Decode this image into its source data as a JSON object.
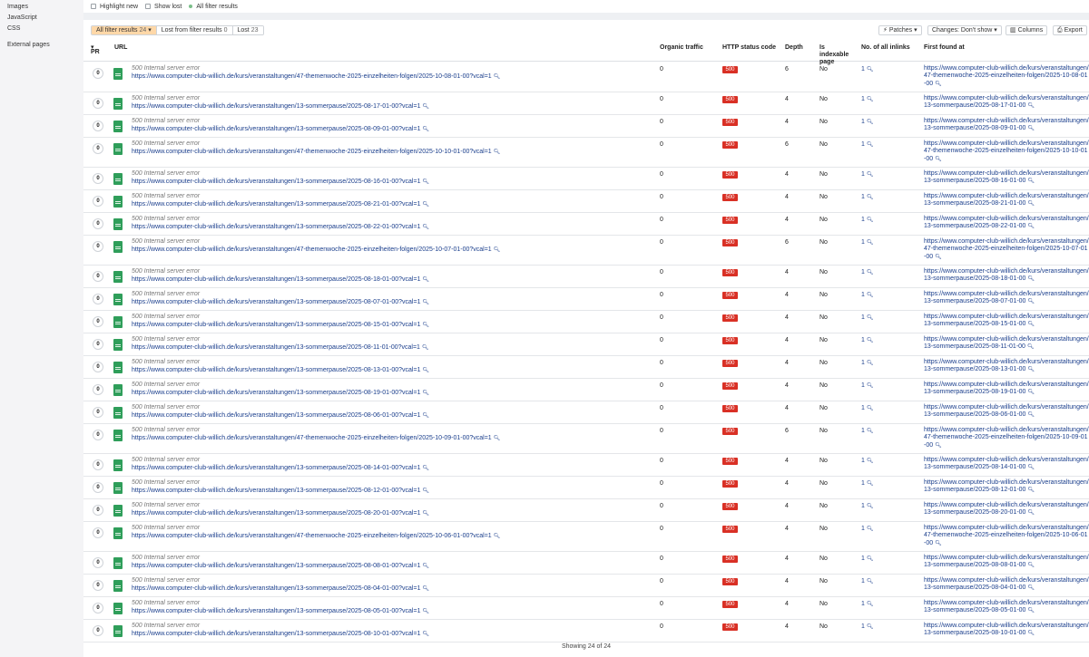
{
  "sidebar": {
    "items": [
      "Images",
      "JavaScript",
      "CSS",
      "External pages"
    ]
  },
  "filters": {
    "highlight_new": "Highlight new",
    "show_lost": "Show lost",
    "all_filter_results": "All filter results"
  },
  "tabs": [
    {
      "label": "All filter results",
      "count": "24"
    },
    {
      "label": "Lost from filter results",
      "count": "0"
    },
    {
      "label": "Lost",
      "count": "23"
    }
  ],
  "toolbar": {
    "patches": "Patches",
    "changes": "Changes: Don't show",
    "columns": "Columns",
    "export": "Export"
  },
  "columns": {
    "pr": "PR",
    "url": "URL",
    "organic_traffic": "Organic traffic",
    "http_status": "HTTP status code",
    "depth": "Depth",
    "indexable": "Is indexable page",
    "inlinks": "No. of all inlinks",
    "first_found": "First found at"
  },
  "rows": [
    {
      "pr": "0",
      "error": "500 Internal server error",
      "url": "https://www.computer-club-willich.de/kurs/veranstaltungen/47-themenwoche-2025-einzelheiten-folgen/2025-10-08-01-00?vcal=1",
      "traffic": "0",
      "status": "500",
      "depth": "6",
      "indexable": "No",
      "inlinks": "1",
      "first_found": "https://www.computer-club-willich.de/kurs/veranstaltungen/47-themenwoche-2025-einzelheiten-folgen/2025-10-08-01-00"
    },
    {
      "pr": "0",
      "error": "500 Internal server error",
      "url": "https://www.computer-club-willich.de/kurs/veranstaltungen/13-sommerpause/2025-08-17-01-00?vcal=1",
      "traffic": "0",
      "status": "500",
      "depth": "4",
      "indexable": "No",
      "inlinks": "1",
      "first_found": "https://www.computer-club-willich.de/kurs/veranstaltungen/13-sommerpause/2025-08-17-01-00"
    },
    {
      "pr": "0",
      "error": "500 Internal server error",
      "url": "https://www.computer-club-willich.de/kurs/veranstaltungen/13-sommerpause/2025-08-09-01-00?vcal=1",
      "traffic": "0",
      "status": "500",
      "depth": "4",
      "indexable": "No",
      "inlinks": "1",
      "first_found": "https://www.computer-club-willich.de/kurs/veranstaltungen/13-sommerpause/2025-08-09-01-00"
    },
    {
      "pr": "0",
      "error": "500 Internal server error",
      "url": "https://www.computer-club-willich.de/kurs/veranstaltungen/47-themenwoche-2025-einzelheiten-folgen/2025-10-10-01-00?vcal=1",
      "traffic": "0",
      "status": "500",
      "depth": "6",
      "indexable": "No",
      "inlinks": "1",
      "first_found": "https://www.computer-club-willich.de/kurs/veranstaltungen/47-themenwoche-2025-einzelheiten-folgen/2025-10-10-01-00"
    },
    {
      "pr": "0",
      "error": "500 Internal server error",
      "url": "https://www.computer-club-willich.de/kurs/veranstaltungen/13-sommerpause/2025-08-16-01-00?vcal=1",
      "traffic": "0",
      "status": "500",
      "depth": "4",
      "indexable": "No",
      "inlinks": "1",
      "first_found": "https://www.computer-club-willich.de/kurs/veranstaltungen/13-sommerpause/2025-08-16-01-00"
    },
    {
      "pr": "0",
      "error": "500 Internal server error",
      "url": "https://www.computer-club-willich.de/kurs/veranstaltungen/13-sommerpause/2025-08-21-01-00?vcal=1",
      "traffic": "0",
      "status": "500",
      "depth": "4",
      "indexable": "No",
      "inlinks": "1",
      "first_found": "https://www.computer-club-willich.de/kurs/veranstaltungen/13-sommerpause/2025-08-21-01-00"
    },
    {
      "pr": "0",
      "error": "500 Internal server error",
      "url": "https://www.computer-club-willich.de/kurs/veranstaltungen/13-sommerpause/2025-08-22-01-00?vcal=1",
      "traffic": "0",
      "status": "500",
      "depth": "4",
      "indexable": "No",
      "inlinks": "1",
      "first_found": "https://www.computer-club-willich.de/kurs/veranstaltungen/13-sommerpause/2025-08-22-01-00"
    },
    {
      "pr": "0",
      "error": "500 Internal server error",
      "url": "https://www.computer-club-willich.de/kurs/veranstaltungen/47-themenwoche-2025-einzelheiten-folgen/2025-10-07-01-00?vcal=1",
      "traffic": "0",
      "status": "500",
      "depth": "6",
      "indexable": "No",
      "inlinks": "1",
      "first_found": "https://www.computer-club-willich.de/kurs/veranstaltungen/47-themenwoche-2025-einzelheiten-folgen/2025-10-07-01-00"
    },
    {
      "pr": "0",
      "error": "500 Internal server error",
      "url": "https://www.computer-club-willich.de/kurs/veranstaltungen/13-sommerpause/2025-08-18-01-00?vcal=1",
      "traffic": "0",
      "status": "500",
      "depth": "4",
      "indexable": "No",
      "inlinks": "1",
      "first_found": "https://www.computer-club-willich.de/kurs/veranstaltungen/13-sommerpause/2025-08-18-01-00"
    },
    {
      "pr": "0",
      "error": "500 Internal server error",
      "url": "https://www.computer-club-willich.de/kurs/veranstaltungen/13-sommerpause/2025-08-07-01-00?vcal=1",
      "traffic": "0",
      "status": "500",
      "depth": "4",
      "indexable": "No",
      "inlinks": "1",
      "first_found": "https://www.computer-club-willich.de/kurs/veranstaltungen/13-sommerpause/2025-08-07-01-00"
    },
    {
      "pr": "0",
      "error": "500 Internal server error",
      "url": "https://www.computer-club-willich.de/kurs/veranstaltungen/13-sommerpause/2025-08-15-01-00?vcal=1",
      "traffic": "0",
      "status": "500",
      "depth": "4",
      "indexable": "No",
      "inlinks": "1",
      "first_found": "https://www.computer-club-willich.de/kurs/veranstaltungen/13-sommerpause/2025-08-15-01-00"
    },
    {
      "pr": "0",
      "error": "500 Internal server error",
      "url": "https://www.computer-club-willich.de/kurs/veranstaltungen/13-sommerpause/2025-08-11-01-00?vcal=1",
      "traffic": "0",
      "status": "500",
      "depth": "4",
      "indexable": "No",
      "inlinks": "1",
      "first_found": "https://www.computer-club-willich.de/kurs/veranstaltungen/13-sommerpause/2025-08-11-01-00"
    },
    {
      "pr": "0",
      "error": "500 Internal server error",
      "url": "https://www.computer-club-willich.de/kurs/veranstaltungen/13-sommerpause/2025-08-13-01-00?vcal=1",
      "traffic": "0",
      "status": "500",
      "depth": "4",
      "indexable": "No",
      "inlinks": "1",
      "first_found": "https://www.computer-club-willich.de/kurs/veranstaltungen/13-sommerpause/2025-08-13-01-00"
    },
    {
      "pr": "0",
      "error": "500 Internal server error",
      "url": "https://www.computer-club-willich.de/kurs/veranstaltungen/13-sommerpause/2025-08-19-01-00?vcal=1",
      "traffic": "0",
      "status": "500",
      "depth": "4",
      "indexable": "No",
      "inlinks": "1",
      "first_found": "https://www.computer-club-willich.de/kurs/veranstaltungen/13-sommerpause/2025-08-19-01-00"
    },
    {
      "pr": "0",
      "error": "500 Internal server error",
      "url": "https://www.computer-club-willich.de/kurs/veranstaltungen/13-sommerpause/2025-08-06-01-00?vcal=1",
      "traffic": "0",
      "status": "500",
      "depth": "4",
      "indexable": "No",
      "inlinks": "1",
      "first_found": "https://www.computer-club-willich.de/kurs/veranstaltungen/13-sommerpause/2025-08-06-01-00"
    },
    {
      "pr": "0",
      "error": "500 Internal server error",
      "url": "https://www.computer-club-willich.de/kurs/veranstaltungen/47-themenwoche-2025-einzelheiten-folgen/2025-10-09-01-00?vcal=1",
      "traffic": "0",
      "status": "500",
      "depth": "6",
      "indexable": "No",
      "inlinks": "1",
      "first_found": "https://www.computer-club-willich.de/kurs/veranstaltungen/47-themenwoche-2025-einzelheiten-folgen/2025-10-09-01-00"
    },
    {
      "pr": "0",
      "error": "500 Internal server error",
      "url": "https://www.computer-club-willich.de/kurs/veranstaltungen/13-sommerpause/2025-08-14-01-00?vcal=1",
      "traffic": "0",
      "status": "500",
      "depth": "4",
      "indexable": "No",
      "inlinks": "1",
      "first_found": "https://www.computer-club-willich.de/kurs/veranstaltungen/13-sommerpause/2025-08-14-01-00"
    },
    {
      "pr": "0",
      "error": "500 Internal server error",
      "url": "https://www.computer-club-willich.de/kurs/veranstaltungen/13-sommerpause/2025-08-12-01-00?vcal=1",
      "traffic": "0",
      "status": "500",
      "depth": "4",
      "indexable": "No",
      "inlinks": "1",
      "first_found": "https://www.computer-club-willich.de/kurs/veranstaltungen/13-sommerpause/2025-08-12-01-00"
    },
    {
      "pr": "0",
      "error": "500 Internal server error",
      "url": "https://www.computer-club-willich.de/kurs/veranstaltungen/13-sommerpause/2025-08-20-01-00?vcal=1",
      "traffic": "0",
      "status": "500",
      "depth": "4",
      "indexable": "No",
      "inlinks": "1",
      "first_found": "https://www.computer-club-willich.de/kurs/veranstaltungen/13-sommerpause/2025-08-20-01-00"
    },
    {
      "pr": "0",
      "error": "500 Internal server error",
      "url": "https://www.computer-club-willich.de/kurs/veranstaltungen/47-themenwoche-2025-einzelheiten-folgen/2025-10-06-01-00?vcal=1",
      "traffic": "0",
      "status": "500",
      "depth": "4",
      "indexable": "No",
      "inlinks": "1",
      "first_found": "https://www.computer-club-willich.de/kurs/veranstaltungen/47-themenwoche-2025-einzelheiten-folgen/2025-10-06-01-00"
    },
    {
      "pr": "0",
      "error": "500 Internal server error",
      "url": "https://www.computer-club-willich.de/kurs/veranstaltungen/13-sommerpause/2025-08-08-01-00?vcal=1",
      "traffic": "0",
      "status": "500",
      "depth": "4",
      "indexable": "No",
      "inlinks": "1",
      "first_found": "https://www.computer-club-willich.de/kurs/veranstaltungen/13-sommerpause/2025-08-08-01-00"
    },
    {
      "pr": "0",
      "error": "500 Internal server error",
      "url": "https://www.computer-club-willich.de/kurs/veranstaltungen/13-sommerpause/2025-08-04-01-00?vcal=1",
      "traffic": "0",
      "status": "500",
      "depth": "4",
      "indexable": "No",
      "inlinks": "1",
      "first_found": "https://www.computer-club-willich.de/kurs/veranstaltungen/13-sommerpause/2025-08-04-01-00"
    },
    {
      "pr": "0",
      "error": "500 Internal server error",
      "url": "https://www.computer-club-willich.de/kurs/veranstaltungen/13-sommerpause/2025-08-05-01-00?vcal=1",
      "traffic": "0",
      "status": "500",
      "depth": "4",
      "indexable": "No",
      "inlinks": "1",
      "first_found": "https://www.computer-club-willich.de/kurs/veranstaltungen/13-sommerpause/2025-08-05-01-00"
    },
    {
      "pr": "0",
      "error": "500 Internal server error",
      "url": "https://www.computer-club-willich.de/kurs/veranstaltungen/13-sommerpause/2025-08-10-01-00?vcal=1",
      "traffic": "0",
      "status": "500",
      "depth": "4",
      "indexable": "No",
      "inlinks": "1",
      "first_found": "https://www.computer-club-willich.de/kurs/veranstaltungen/13-sommerpause/2025-08-10-01-00"
    }
  ],
  "footer": {
    "showing": "Showing 24 of 24"
  }
}
